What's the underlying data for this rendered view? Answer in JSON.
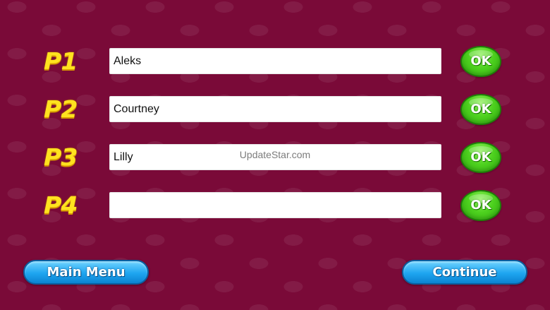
{
  "players": [
    {
      "label": "P1",
      "name": "Aleks",
      "ok_label": "OK"
    },
    {
      "label": "P2",
      "name": "Courtney",
      "ok_label": "OK"
    },
    {
      "label": "P3",
      "name": "Lilly",
      "ok_label": "OK"
    },
    {
      "label": "P4",
      "name": "",
      "ok_label": "OK"
    }
  ],
  "buttons": {
    "main_menu": "Main Menu",
    "continue": "Continue"
  },
  "watermark": "UpdateStar.com",
  "colors": {
    "background": "#7a0a38",
    "label": "#ffe21f",
    "ok_button": "#4ed21f",
    "nav_button": "#1ea5f0"
  }
}
